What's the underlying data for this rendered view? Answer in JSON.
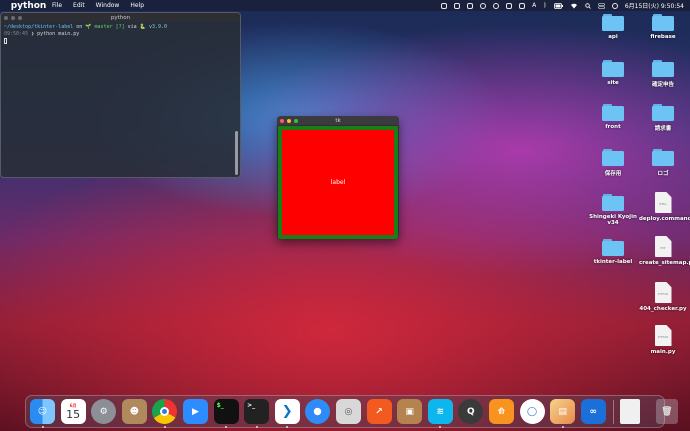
{
  "menubar": {
    "apple": "",
    "items": [
      "python",
      "File",
      "Edit",
      "Window",
      "Help"
    ],
    "status_letter": "A",
    "clock": "6月15日(火) 9:50:54"
  },
  "terminal": {
    "title": "python",
    "line1_path": "~/desktop/tkinter-label",
    "line1_on": " on ",
    "line1_branch": "🌱 master [?]",
    "line1_via": " via ",
    "line1_py": "🐍 v3.9.0",
    "line2_time": "09:50:45",
    "line2_cmd": " ❯ python main.py"
  },
  "tk_window": {
    "title": "tk",
    "label_text": "label",
    "frame_color": "#1a7d16",
    "label_color": "#ff0000"
  },
  "desktop_icons": [
    {
      "label": "api",
      "kind": "folder"
    },
    {
      "label": "firebase",
      "kind": "folder"
    },
    {
      "label": "site",
      "kind": "folder"
    },
    {
      "label": "確定申告",
      "kind": "folder"
    },
    {
      "label": "front",
      "kind": "folder"
    },
    {
      "label": "請求書",
      "kind": "folder"
    },
    {
      "label": "保存用",
      "kind": "folder"
    },
    {
      "label": "ロゴ",
      "kind": "folder"
    },
    {
      "label": "Shingeki Kyojin v34",
      "kind": "folder"
    },
    {
      "label": "deploy.command",
      "kind": "file",
      "tag": "SHELL"
    },
    {
      "label": "tkinter-label",
      "kind": "folder"
    },
    {
      "label": "create_sitemap.php",
      "kind": "file",
      "tag": "PHP"
    },
    {
      "label": "404_checker.py",
      "kind": "file",
      "tag": "PYTHON"
    },
    {
      "label": "main.py",
      "kind": "file",
      "tag": "PYTHON"
    }
  ],
  "dock": {
    "calendar_month": "6月",
    "calendar_day": "15",
    "apps": [
      "finder-icon",
      "calendar-icon",
      "system-preferences-icon",
      "contacts-icon",
      "chrome-icon",
      "zoom-icon",
      "iterm-icon",
      "terminal-icon",
      "vscode-icon",
      "safari-icon",
      "sequel-icon",
      "tableplus-icon",
      "package-icon",
      "docker-icon",
      "quicktime-icon",
      "sourcetree-icon",
      "oracle-icon",
      "preview-icon",
      "infinity-icon"
    ]
  }
}
